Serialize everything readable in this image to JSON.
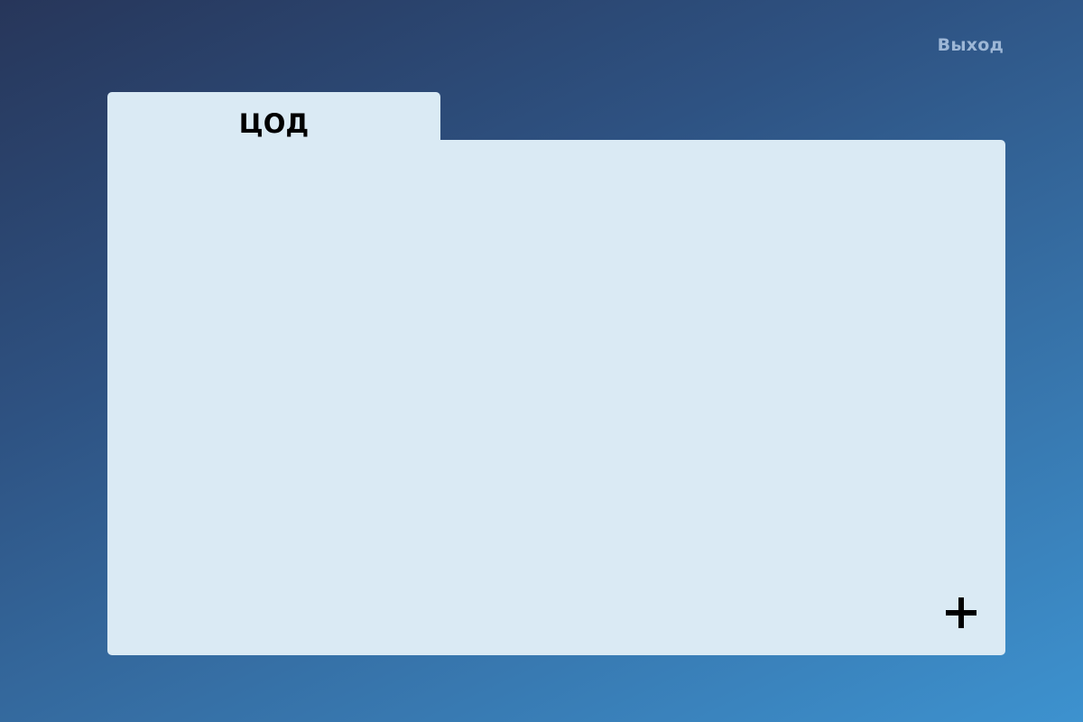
{
  "header": {
    "logout_label": "Выход"
  },
  "folder": {
    "tab_label": "ЦОД"
  },
  "actions": {
    "add_icon": "plus-icon"
  },
  "colors": {
    "background_start": "#27365a",
    "background_end": "#3d92cf",
    "panel": "#daeaf4",
    "logout_text": "#9db7d6",
    "text": "#000000"
  }
}
